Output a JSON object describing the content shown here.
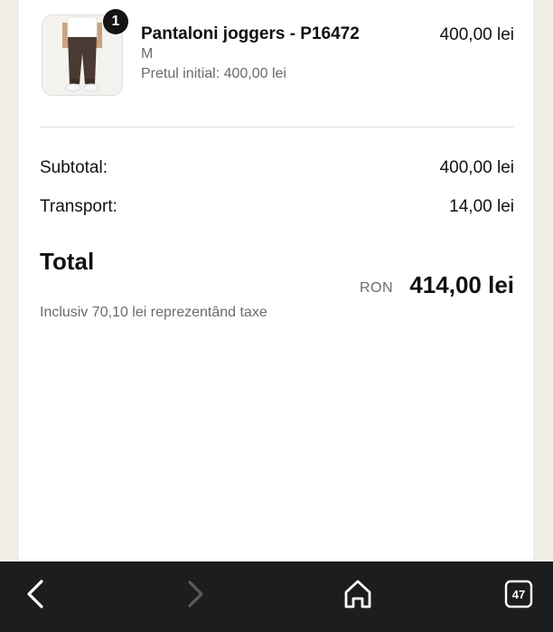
{
  "cart": {
    "item": {
      "quantity_badge": "1",
      "name": "Pantaloni joggers - P16472",
      "variant": "M",
      "original_price": "Pretul initial: 400,00 lei",
      "price": "400,00 lei"
    },
    "summary": {
      "subtotal_label": "Subtotal:",
      "subtotal_value": "400,00 lei",
      "shipping_label": "Transport:",
      "shipping_value": "14,00 lei",
      "total_label": "Total",
      "currency": "RON",
      "total_value": "414,00 lei",
      "taxes_note": "Inclusiv 70,10 lei reprezentând taxe"
    }
  },
  "browser_toolbar": {
    "back_icon": "chevron-left-icon",
    "forward_icon": "chevron-right-icon",
    "home_icon": "home-icon",
    "tabs_count": "47"
  }
}
